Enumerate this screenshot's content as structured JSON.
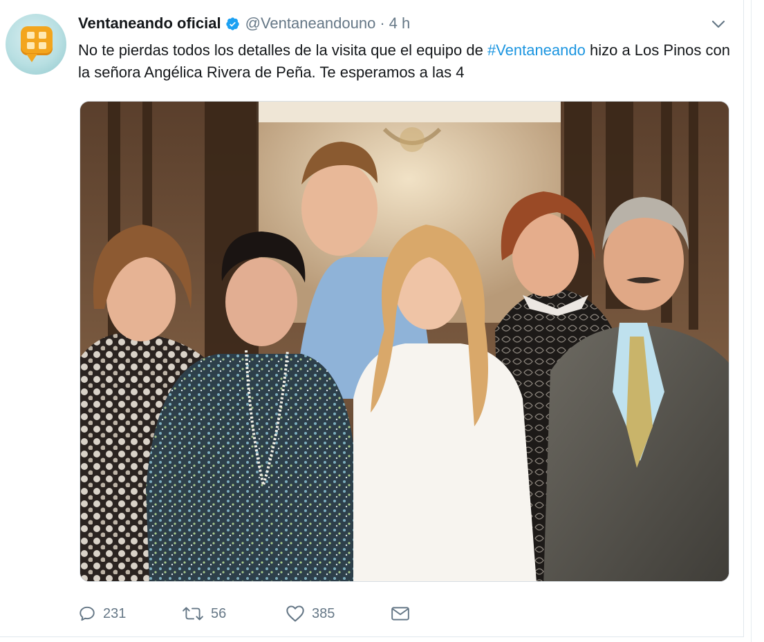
{
  "tweet": {
    "author_name": "Ventaneando oficial",
    "author_handle": "@Ventaneandouno",
    "separator": "·",
    "timestamp": "4 h",
    "text_before": "No te pierdas todos los detalles de la visita que el equipo de ",
    "hashtag": "#Ventaneando",
    "text_after": " hizo a Los Pinos con la señora Angélica Rivera de Peña. Te esperamos a las 4",
    "accent_color": "#1b95e0",
    "icons": {
      "verified": "verified-badge-icon",
      "more": "chevron-down-icon",
      "reply": "reply-icon",
      "retweet": "retweet-icon",
      "like": "heart-icon",
      "dm": "envelope-icon"
    }
  },
  "actions": {
    "replies": "231",
    "retweets": "56",
    "likes": "385"
  }
}
